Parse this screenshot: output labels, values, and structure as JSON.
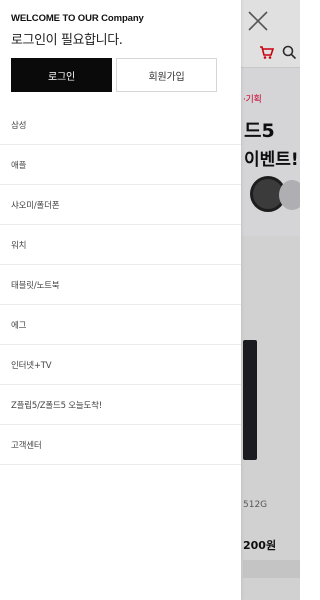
{
  "drawer": {
    "welcome": "WELCOME TO OUR Company",
    "login_message": "로그인이 필요합니다.",
    "login_button": "로그인",
    "signup_button": "회원가입",
    "menu": [
      {
        "label": "삼성"
      },
      {
        "label": "애플"
      },
      {
        "label": "샤오미/폴더폰"
      },
      {
        "label": "워치"
      },
      {
        "label": "태블릿/노트북"
      },
      {
        "label": "에그"
      },
      {
        "label": "인터넷+TV"
      },
      {
        "label": "Z플립5/Z폴드5 오늘도착!"
      },
      {
        "label": "고객센터"
      }
    ]
  },
  "background": {
    "banner_tag": "·기획",
    "banner_title_1": "드5",
    "banner_title_2": "이벤트!",
    "product_model": "512G",
    "product_price": "200원"
  },
  "colors": {
    "login_bg": "#0a0a0a",
    "accent_red": "#e4003a"
  },
  "icons": {
    "close": "close-icon",
    "cart": "cart-icon",
    "search": "search-icon"
  }
}
